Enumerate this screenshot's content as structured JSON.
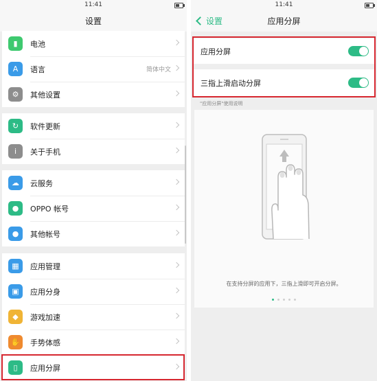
{
  "left": {
    "status_time": "11:41",
    "title": "设置",
    "groups": [
      [
        {
          "icon": "battery-icon",
          "label": "电池",
          "color": "#3ec96f",
          "value": ""
        },
        {
          "icon": "language-icon",
          "label": "语言",
          "color": "#3a9be8",
          "value": "简体中文"
        },
        {
          "icon": "gear-icon",
          "label": "其他设置",
          "color": "#8d8d8d",
          "value": ""
        }
      ],
      [
        {
          "icon": "update-icon",
          "label": "软件更新",
          "color": "#2dbb86",
          "value": ""
        },
        {
          "icon": "info-icon",
          "label": "关于手机",
          "color": "#8d8d8d",
          "value": ""
        }
      ],
      [
        {
          "icon": "cloud-icon",
          "label": "云服务",
          "color": "#3a9be8",
          "value": ""
        },
        {
          "icon": "account-icon",
          "label": "OPPO 帐号",
          "color": "#2dbb86",
          "value": ""
        },
        {
          "icon": "other-accounts-icon",
          "label": "其他帐号",
          "color": "#3a9be8",
          "value": ""
        }
      ],
      [
        {
          "icon": "app-manage-icon",
          "label": "应用管理",
          "color": "#3a9be8",
          "value": ""
        },
        {
          "icon": "app-clone-icon",
          "label": "应用分身",
          "color": "#3a9be8",
          "value": ""
        },
        {
          "icon": "game-accel-icon",
          "label": "游戏加速",
          "color": "#f0b435",
          "value": ""
        },
        {
          "icon": "gesture-icon",
          "label": "手势体感",
          "color": "#ef8a2f",
          "value": ""
        },
        {
          "icon": "split-screen-icon",
          "label": "应用分屏",
          "color": "#2dbb86",
          "value": ""
        }
      ]
    ]
  },
  "right": {
    "status_time": "11:41",
    "title": "应用分屏",
    "back_label": "设置",
    "toggles": [
      {
        "label": "应用分屏",
        "on": true
      },
      {
        "label": "三指上滑启动分屏",
        "on": true
      }
    ],
    "caption": "\"应用分屏\"使用说明",
    "description": "在支持分屏的应用下，三指上滑即可开启分屏。",
    "page_count": 5,
    "active_page": 1
  },
  "accent_color": "#2dbb86",
  "highlight_color": "#d6262f"
}
